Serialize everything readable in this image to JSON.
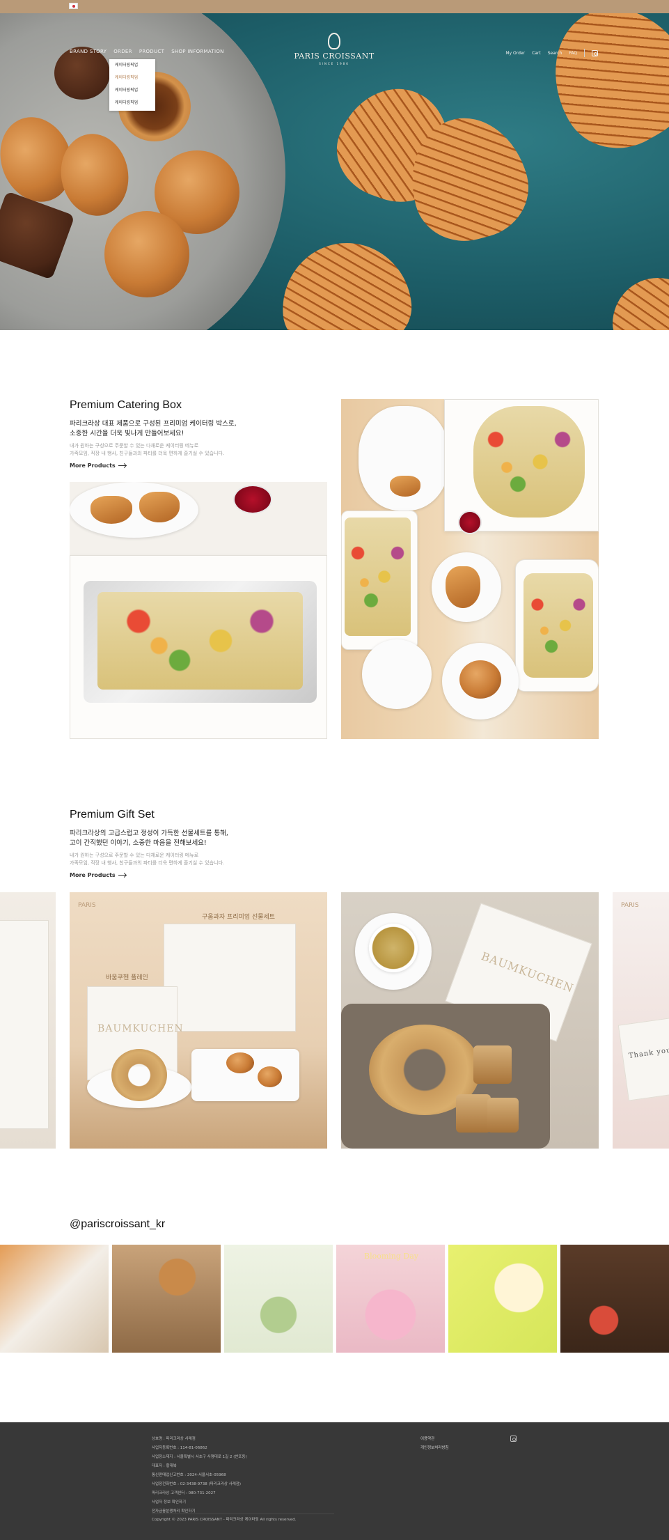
{
  "top_bar": {
    "flag_icon": "korea-flag-icon"
  },
  "nav": {
    "items": [
      "BRAND STORY",
      "ORDER",
      "PRODUCT",
      "SHOP INFORMATION"
    ],
    "dropdown": [
      "케이터링픽업",
      "케이터링픽업",
      "케이터링픽업",
      "케이터링픽업"
    ],
    "logo_text": "PARIS CROISSANT",
    "logo_since": "SINCE 1986",
    "right_items": [
      "My Order",
      "Cart",
      "Search",
      "FAQ"
    ],
    "instagram_icon": "instagram-icon"
  },
  "catering": {
    "title": "Premium Catering Box",
    "headline_1": "파리크라상 대표 제품으로 구성된 프리미엄 케이터링 박스로,",
    "headline_2": "소중한 시간을 더욱 빛나게 만들어보세요!",
    "body_1": "내가 원하는 구성으로 주문할 수 있는 다채로운 케이터링 메뉴로",
    "body_2": "가족모임, 직장 내 행사, 친구들과의 파티를 더욱 편하게 즐기실 수 있습니다.",
    "more_label": "More Products"
  },
  "gift": {
    "title": "Premium Gift Set",
    "headline_1": "파리크라상의 고급스럽고 정성이 가득한 선물세트를 통해,",
    "headline_2": "고이 간직했던 이야기, 소중한 마음을 전해보세요!",
    "body_1": "내가 원하는 구성으로 주문할 수 있는 다채로운 케이터링 메뉴로",
    "body_2": "가족모임, 직장 내 행사, 친구들과의 파티를 더욱 편하게 즐기실 수 있습니다.",
    "more_label": "More Products",
    "photo_text_1": "구움과자 프리미엄 선물세트",
    "photo_text_2": "바움쿠헨 플레인",
    "photo_box_label": "BAUMKUCHEN",
    "photo_paris": "PARIS",
    "photo_thankyou": "Thank you"
  },
  "instagram": {
    "handle": "@pariscroissant_kr",
    "blooming": "Blooming Day"
  },
  "footer": {
    "info": [
      "상호명 : 파리크라상 사례점",
      "사업자등록번호 : 114-81-06862",
      "사업장소재지 : 서울특별시 서초구 사평대로 1길 2 (반포동)",
      "대표자 : 황재복",
      "통신판매업신고번호 : 2024-서울서초-05968",
      "사업장전화번호 : 02-3438-9738 (파리크라상 사례점)",
      "파리크라상 고객센터 : 080-731-2027",
      "사업자 정보 확인하기",
      "전자금융분쟁처리 확인하기"
    ],
    "copyright": "Copyright © 2023 PARIS CROISSANT - 파리크라상 케이터링 All rights reserved.",
    "links": [
      "이용약관",
      "개인정보처리방침"
    ],
    "instagram_icon": "instagram-icon"
  },
  "colors": {
    "topbar": "#b99a78",
    "footer": "#383838",
    "accent": "#b07a4a"
  }
}
